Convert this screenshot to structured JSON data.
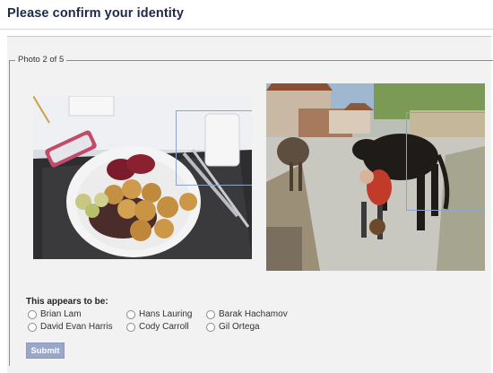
{
  "header": {
    "title": "Please confirm your identity"
  },
  "legend": "Photo 2 of 5",
  "photos": [
    {
      "description_icon": "photo-food-plate-icon"
    },
    {
      "description_icon": "photo-donkey-village-icon"
    }
  ],
  "question": {
    "prompt": "This appears to be:",
    "options": [
      "Brian Lam",
      "Hans Lauring",
      "Barak Hachamov",
      "David Evan Harris",
      "Cody Carroll",
      "Gil Ortega"
    ]
  },
  "submit_label": "Submit",
  "colors": {
    "accent": "#1c2a47",
    "button": "#9aa7c8",
    "face_box": "#8fa3c6"
  }
}
